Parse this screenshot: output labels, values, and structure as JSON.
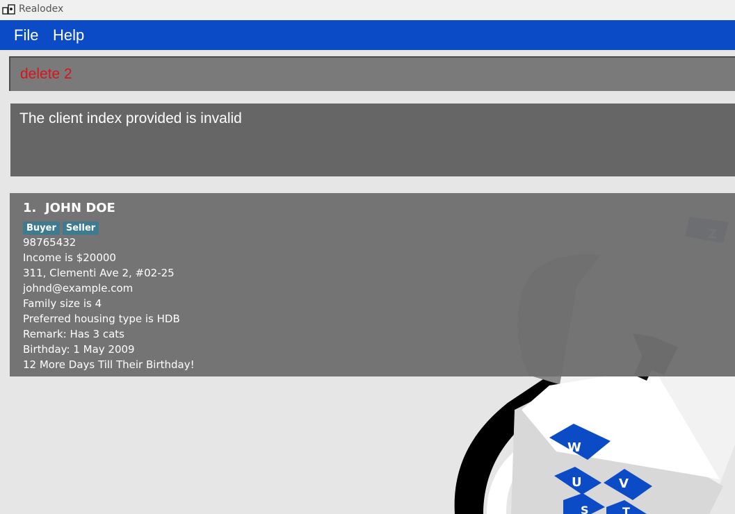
{
  "window": {
    "title": "Realodex"
  },
  "menu": {
    "file": "File",
    "help": "Help"
  },
  "command": {
    "value": "delete 2"
  },
  "result": {
    "message": "The client index provided is invalid"
  },
  "client": {
    "index": "1.",
    "name": "JOHN DOE",
    "tags": [
      "Buyer",
      "Seller"
    ],
    "phone": "98765432",
    "income": "Income is $20000",
    "address": "311, Clementi Ave 2, #02-25",
    "email": "johnd@example.com",
    "family": "Family size is 4",
    "housing": "Preferred housing type is HDB",
    "remark": "Remark: Has 3 cats",
    "birthday": "Birthday: 1 May 2009",
    "countdown": "12 More Days Till Their Birthday!"
  },
  "background_art": {
    "letters": [
      "Z",
      "W",
      "U",
      "V",
      "S",
      "T"
    ]
  },
  "colors": {
    "menubar": "#0b4bc6",
    "command_text": "#d8141c",
    "tag": "#3e7b91",
    "card": "#707070",
    "result_box": "#666666"
  }
}
